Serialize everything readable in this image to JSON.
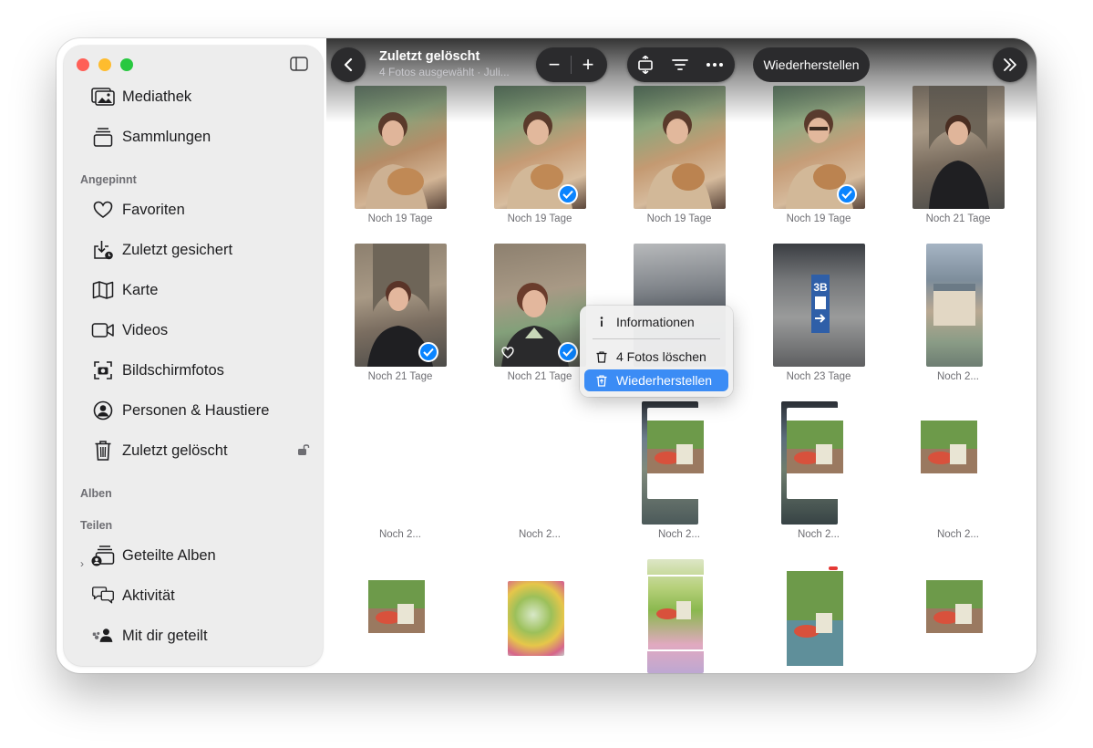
{
  "sidebar": {
    "items_top": [
      {
        "label": "Mediathek",
        "icon": "photo-library-icon"
      },
      {
        "label": "Sammlungen",
        "icon": "collections-icon"
      }
    ],
    "sections": {
      "pinned": "Angepinnt",
      "albums": "Alben",
      "sharing": "Teilen"
    },
    "pinned_items": [
      {
        "label": "Favoriten",
        "icon": "heart-icon"
      },
      {
        "label": "Zuletzt gesichert",
        "icon": "saved-icon"
      },
      {
        "label": "Karte",
        "icon": "map-icon"
      },
      {
        "label": "Videos",
        "icon": "video-icon"
      },
      {
        "label": "Bildschirmfotos",
        "icon": "screenshot-icon"
      },
      {
        "label": "Personen & Haustiere",
        "icon": "person-icon"
      },
      {
        "label": "Zuletzt gelöscht",
        "icon": "trash-icon"
      }
    ],
    "sharing_items": [
      {
        "label": "Geteilte Alben",
        "icon": "shared-albums-icon"
      },
      {
        "label": "Aktivität",
        "icon": "activity-icon"
      },
      {
        "label": "Mit dir geteilt",
        "icon": "shared-with-you-icon"
      }
    ]
  },
  "toolbar": {
    "title": "Zuletzt gelöscht",
    "subtitle": "4 Fotos ausgewählt · Juli...",
    "zoom_out": "−",
    "zoom_in": "+",
    "restore_label": "Wiederherstellen"
  },
  "context_menu": {
    "items": [
      {
        "label": "Informationen",
        "icon": "info-icon"
      },
      {
        "label": "4 Fotos löschen",
        "icon": "trash-icon"
      },
      {
        "label": "Wiederherstellen",
        "icon": "trash-restore-icon",
        "highlighted": true
      }
    ]
  },
  "grid": {
    "rows": [
      [
        "Noch 19 Tage",
        "Noch 19 Tage",
        "Noch 19 Tage",
        "Noch 19 Tage",
        "Noch 21 Tage"
      ],
      [
        "Noch 21 Tage",
        "Noch 21 Tage",
        "",
        "Noch 23 Tage",
        "Noch 2..."
      ],
      [
        "Noch 2...",
        "Noch 2...",
        "Noch 2...",
        "Noch 2...",
        "Noch 2..."
      ],
      [
        "",
        "",
        "",
        "",
        ""
      ]
    ],
    "selected_count": 4
  },
  "colors": {
    "accent": "#0a84ff",
    "menu_highlight": "#3b8cf5",
    "close": "#ff5f57",
    "minimize": "#febc2e",
    "maximize": "#28c840"
  }
}
